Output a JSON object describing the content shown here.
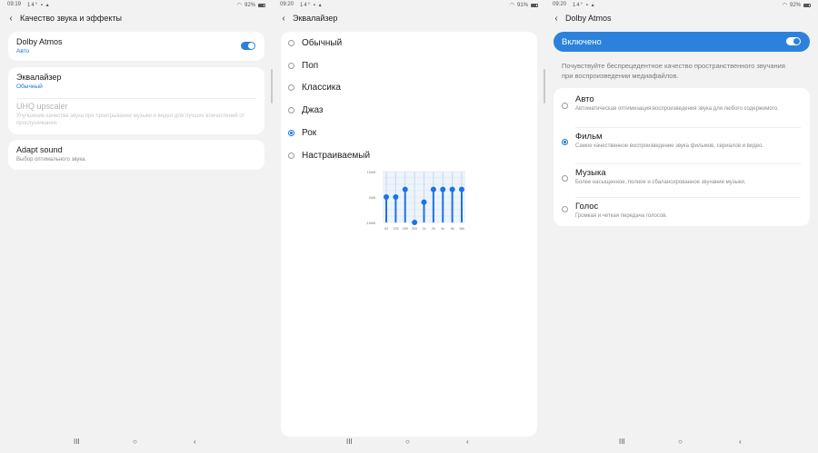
{
  "screens": [
    {
      "status": {
        "time": "09:19",
        "temp": "14°",
        "battery": "92%"
      },
      "header": {
        "title": "Качество звука и эффекты"
      },
      "items": [
        {
          "title": "Dolby Atmos",
          "subtitle": "Авто",
          "toggle": true
        },
        {
          "title": "Эквалайзер",
          "subtitle": "Обычный"
        },
        {
          "title": "UHQ upscaler",
          "subtitle": "Улучшение качества звука при проигрывании музыки и видео для лучших впечатлений от прослушивания."
        },
        {
          "title": "Adapt sound",
          "subtitle": "Выбор оптимального звука."
        }
      ]
    },
    {
      "status": {
        "time": "09:20",
        "temp": "14°",
        "battery": "91%"
      },
      "header": {
        "title": "Эквалайзер"
      },
      "presets": [
        {
          "label": "Обычный",
          "selected": false
        },
        {
          "label": "Поп",
          "selected": false
        },
        {
          "label": "Классика",
          "selected": false
        },
        {
          "label": "Джаз",
          "selected": false
        },
        {
          "label": "Рок",
          "selected": true
        },
        {
          "label": "Настраиваемый",
          "selected": false
        }
      ]
    },
    {
      "status": {
        "time": "09:20",
        "temp": "14°",
        "battery": "92%"
      },
      "header": {
        "title": "Dolby Atmos"
      },
      "banner": {
        "label": "Включено",
        "enabled": true
      },
      "description": "Почувствуйте беспрецедентное качество пространственного звучания при воспроизведении медиафайлов.",
      "modes": [
        {
          "title": "Авто",
          "desc": "Автоматическая оптимизация воспроизведения звука для любого содержимого.",
          "selected": false
        },
        {
          "title": "Фильм",
          "desc": "Самое качественное воспроизведение звука фильмов, сериалов и видео.",
          "selected": true
        },
        {
          "title": "Музыка",
          "desc": "Более насыщенное, полное и сбалансированное звучание музыки.",
          "selected": false
        },
        {
          "title": "Голос",
          "desc": "Громкая и четкая передача голосов.",
          "selected": false
        }
      ]
    }
  ],
  "nav": {
    "recents": "III",
    "home": "○",
    "back": "‹"
  },
  "chart_data": {
    "type": "line",
    "y_tick_labels": [
      "10dB",
      "0dB",
      "-10dB"
    ],
    "ylim": [
      -10,
      10
    ],
    "categories": [
      "63",
      "125",
      "250",
      "500",
      "1k",
      "2k",
      "4k",
      "8k",
      "16k"
    ],
    "values": [
      0,
      0,
      3,
      -10,
      -2,
      3,
      3,
      3,
      3
    ]
  },
  "colors": {
    "accent": "#2c82db",
    "eq_bar": "#1a73e8",
    "background": "#f2f2f2",
    "card": "#ffffff"
  }
}
